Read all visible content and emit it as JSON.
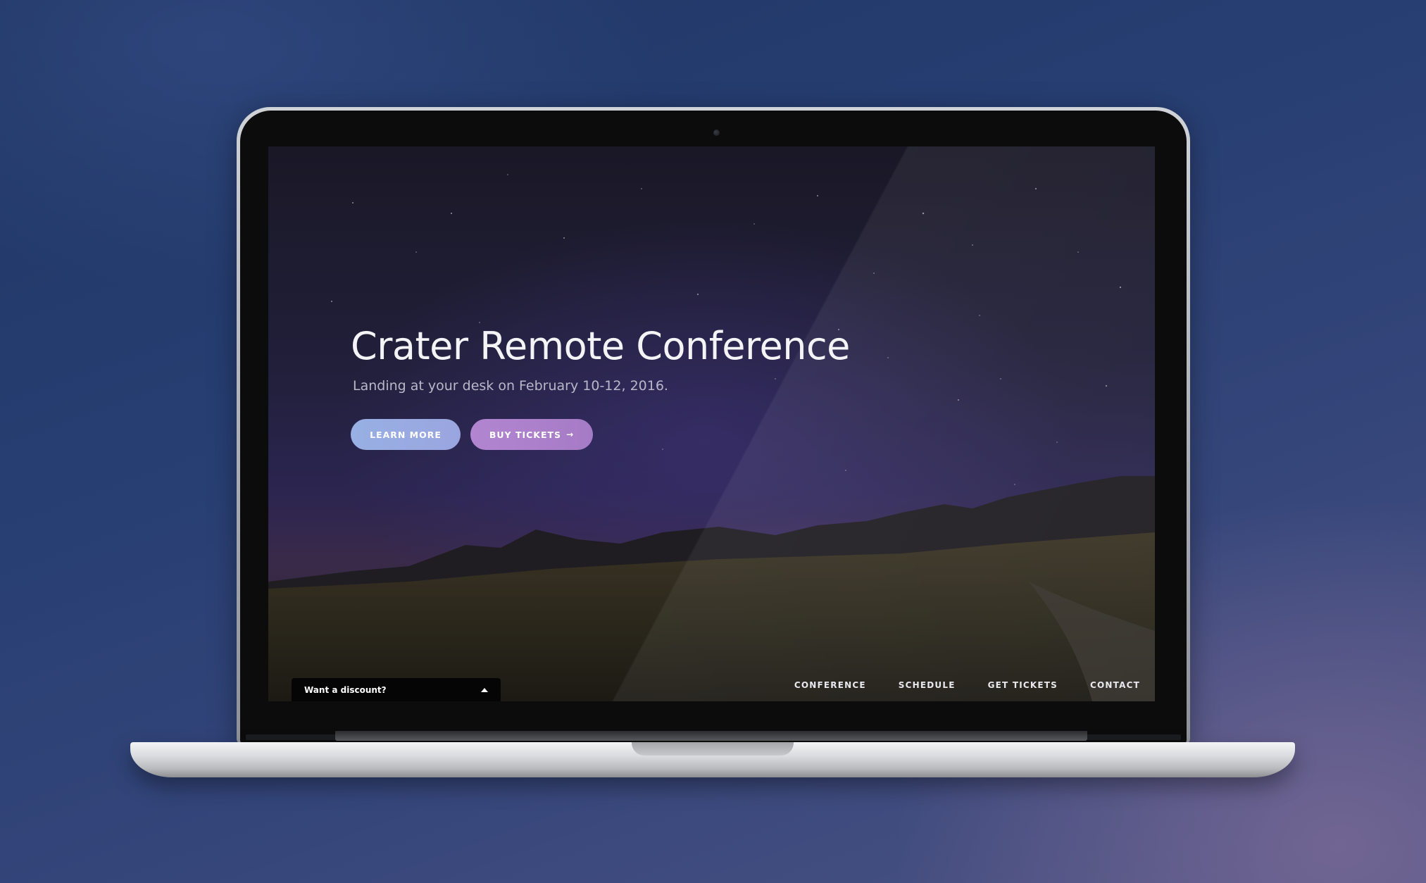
{
  "hero": {
    "title": "Crater Remote Conference",
    "subtitle": "Landing at your desk on February 10-12, 2016.",
    "learn_more_label": "LEARN MORE",
    "buy_tickets_label": "BUY TICKETS",
    "buy_tickets_arrow": "→"
  },
  "discount": {
    "label": "Want a discount?",
    "icon": "caret-up-icon"
  },
  "nav": {
    "items": [
      {
        "label": "CONFERENCE"
      },
      {
        "label": "SCHEDULE"
      },
      {
        "label": "GET TICKETS"
      },
      {
        "label": "CONTACT"
      }
    ]
  },
  "colors": {
    "learn_more_button": "#98b0e4",
    "buy_tickets_button": "#b285d0",
    "background": "#263e72"
  }
}
